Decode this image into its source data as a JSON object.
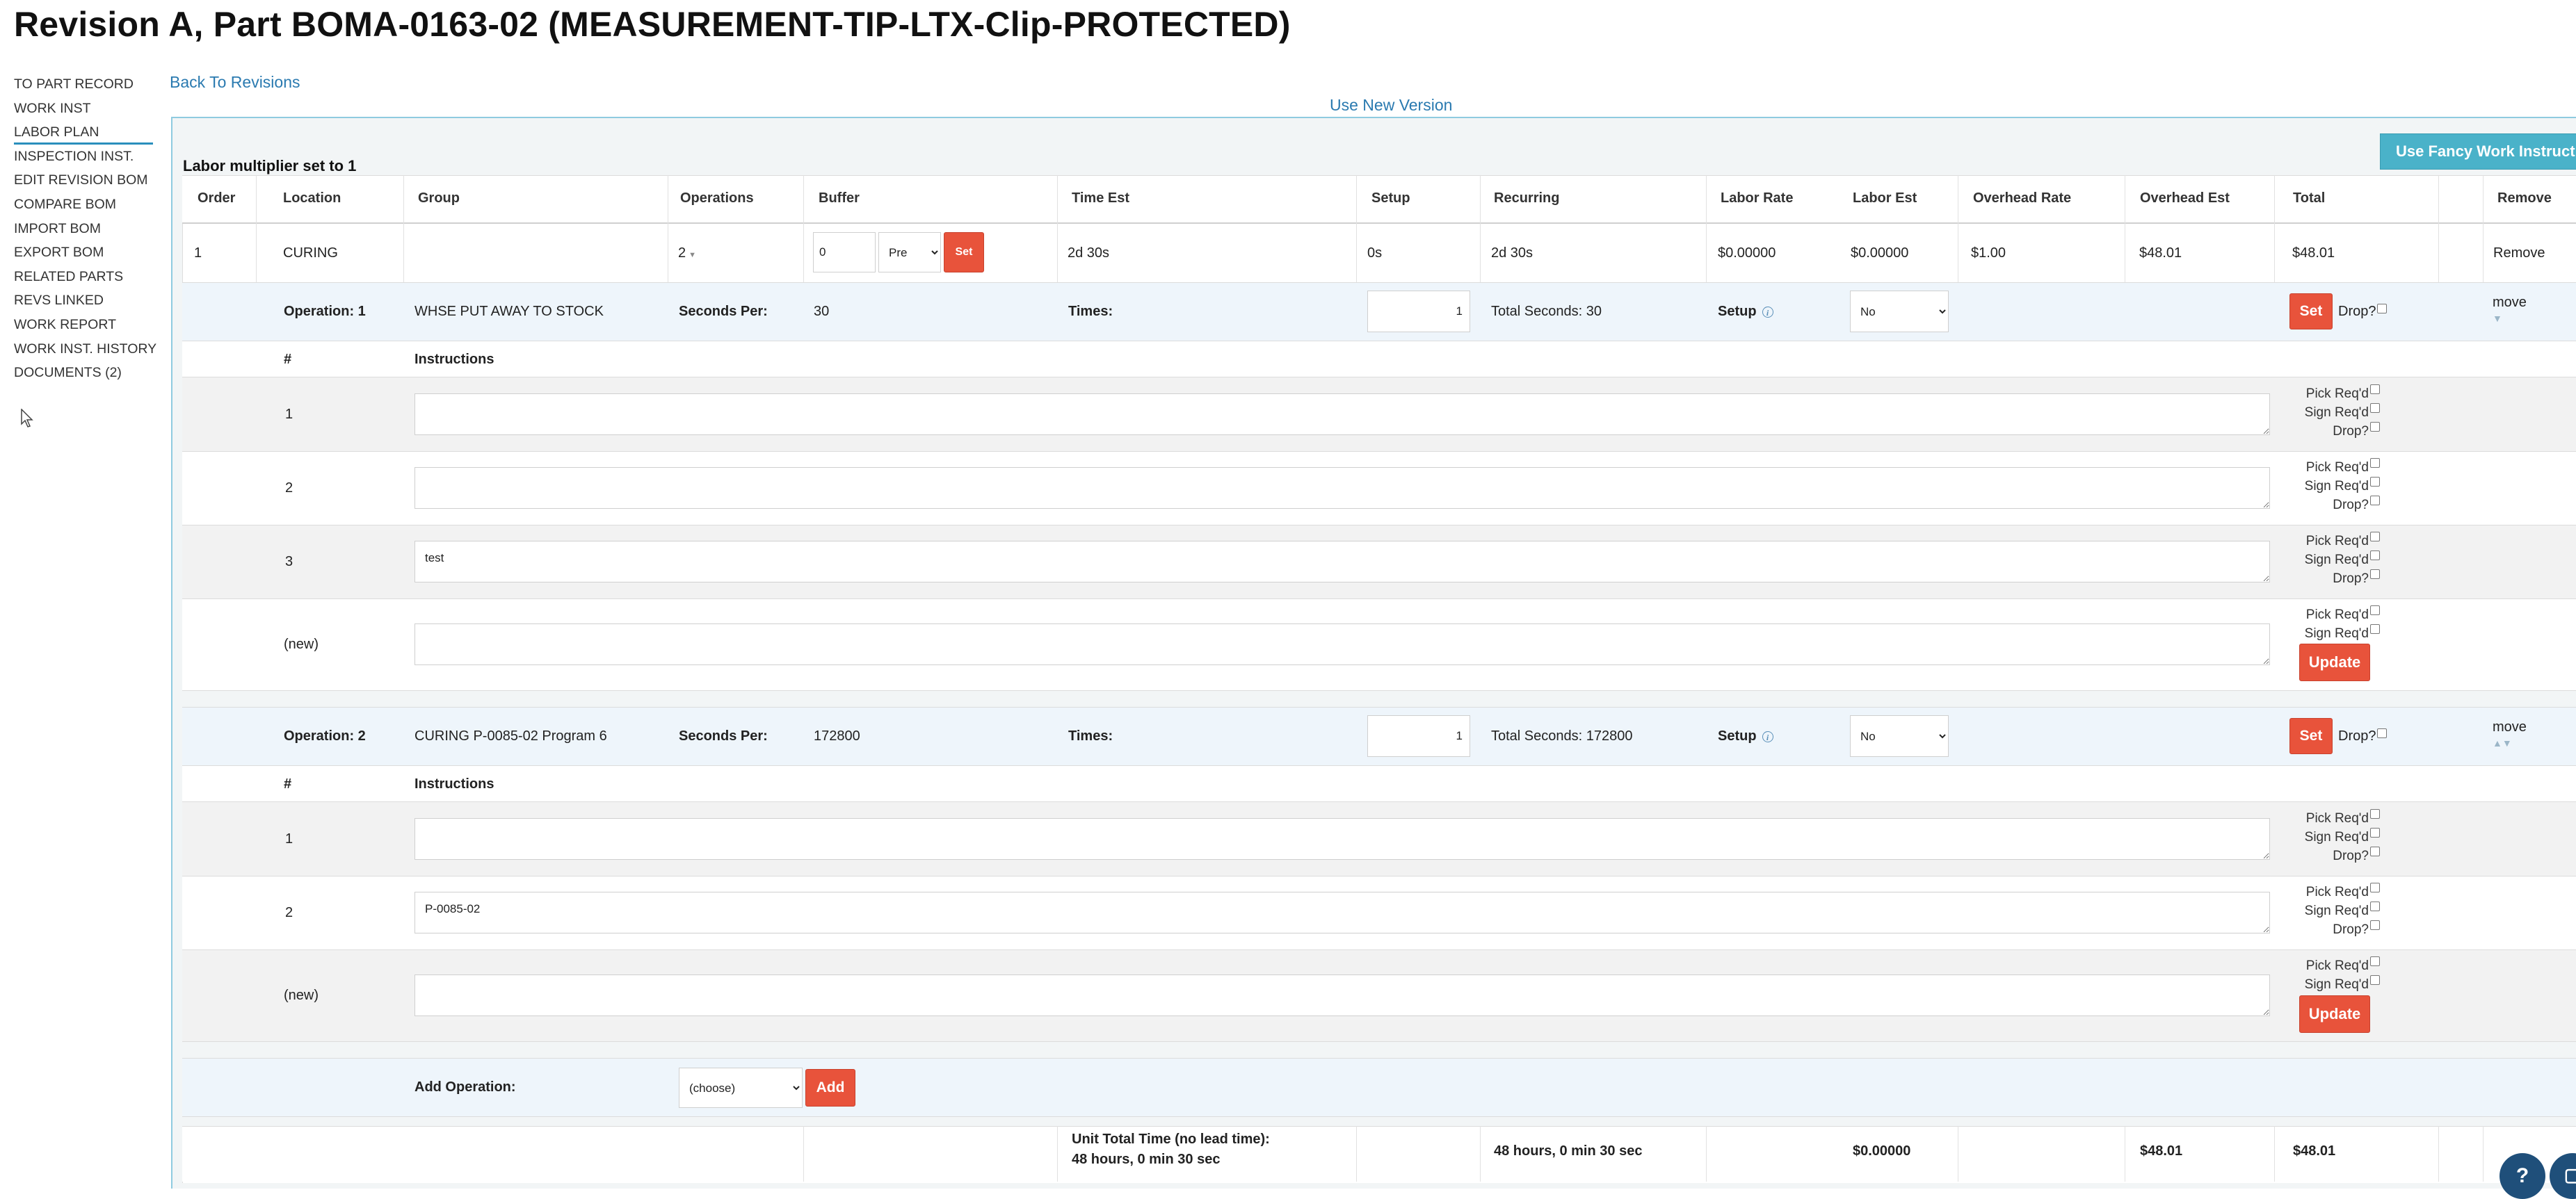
{
  "page": {
    "title": "Revision A, Part BOMA-0163-02 (MEASUREMENT-TIP-LTX-Clip-PROTECTED)"
  },
  "sidebar": {
    "items": [
      {
        "label": "TO PART RECORD"
      },
      {
        "label": "WORK INST"
      },
      {
        "label": "LABOR PLAN"
      },
      {
        "label": "INSPECTION INST."
      },
      {
        "label": "EDIT REVISION BOM"
      },
      {
        "label": "COMPARE BOM"
      },
      {
        "label": "IMPORT BOM"
      },
      {
        "label": "EXPORT BOM"
      },
      {
        "label": "RELATED PARTS"
      },
      {
        "label": "REVS LINKED"
      },
      {
        "label": "WORK REPORT"
      },
      {
        "label": "WORK INST. HISTORY"
      },
      {
        "label": "DOCUMENTS (2)"
      }
    ],
    "active": "LABOR PLAN"
  },
  "links": {
    "back": "Back To Revisions",
    "new_version": "Use New Version"
  },
  "toolbar": {
    "fancy": "Use Fancy Work Instructions"
  },
  "labor": {
    "multiplier_text": "Labor multiplier set to 1",
    "columns": [
      "Order",
      "Location",
      "Group",
      "Operations",
      "Buffer",
      "Time Est",
      "Setup",
      "Recurring",
      "Labor Rate",
      "Labor Est",
      "Overhead Rate",
      "Overhead Est",
      "Total",
      "Remove"
    ],
    "group_row": {
      "order": "1",
      "location": "CURING",
      "group": "",
      "operations": "2",
      "buffer_value": "0",
      "buffer_mode": "Pre",
      "set_label": "Set",
      "time_est": "2d 30s",
      "setup": "0s",
      "recurring": "2d 30s",
      "labor_rate": "$0.00000",
      "labor_est": "$0.00000",
      "overhead_rate": "$1.00",
      "overhead_est": "$48.01",
      "total": "$48.01",
      "remove": "Remove"
    },
    "labels": {
      "seconds_per": "Seconds Per:",
      "times": "Times:",
      "setup": "Setup",
      "set": "Set",
      "drop": "Drop?",
      "move": "move",
      "hash": "#",
      "instructions": "Instructions",
      "pick": "Pick Req'd",
      "sign": "Sign Req'd",
      "update": "Update"
    },
    "operations": [
      {
        "name": "Operation: 1",
        "desc": "WHSE PUT AWAY TO STOCK",
        "seconds_per": "30",
        "times": "1",
        "total_seconds": "Total Seconds: 30",
        "setup_value": "No",
        "instructions": [
          {
            "num": "1",
            "text": ""
          },
          {
            "num": "2",
            "text": ""
          },
          {
            "num": "3",
            "text": "test"
          },
          {
            "num": "(new)",
            "text": ""
          }
        ]
      },
      {
        "name": "Operation: 2",
        "desc": "CURING P-0085-02 Program 6",
        "seconds_per": "172800",
        "times": "1",
        "total_seconds": "Total Seconds: 172800",
        "setup_value": "No",
        "instructions": [
          {
            "num": "1",
            "text": ""
          },
          {
            "num": "2",
            "text": "P-0085-02"
          },
          {
            "num": "(new)",
            "text": ""
          }
        ]
      }
    ],
    "add_operation": {
      "label": "Add Operation:",
      "select_value": "(choose)",
      "button": "Add"
    },
    "totals": {
      "unit_total_label": "Unit Total Time (no lead time):",
      "unit_total_value": "48 hours, 0 min 30 sec",
      "recurring": "48 hours, 0 min 30 sec",
      "labor_est": "$0.00000",
      "overhead_est": "$48.01",
      "total": "$48.01"
    }
  },
  "footer": {
    "help": "?",
    "chat": "▢"
  }
}
